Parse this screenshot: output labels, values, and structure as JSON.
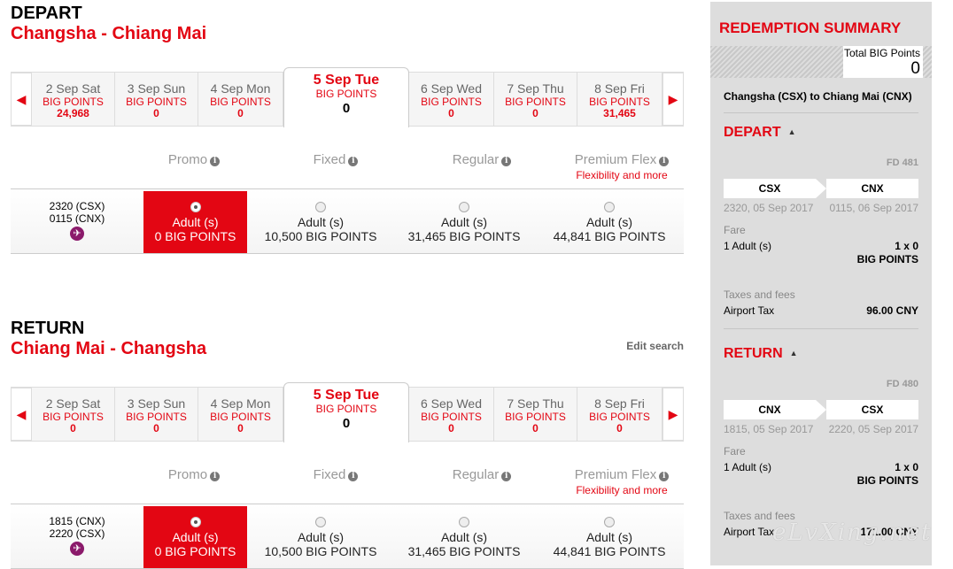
{
  "depart": {
    "heading": "DEPART",
    "route": "Changsha - Chiang Mai",
    "dates": [
      {
        "label": "2 Sep Sat",
        "bp": "BIG POINTS",
        "points": "24,968"
      },
      {
        "label": "3 Sep Sun",
        "bp": "BIG POINTS",
        "points": "0"
      },
      {
        "label": "4 Sep Mon",
        "bp": "BIG POINTS",
        "points": "0"
      },
      {
        "label": "5 Sep Tue",
        "bp": "BIG POINTS",
        "points": "0"
      },
      {
        "label": "6 Sep Wed",
        "bp": "BIG POINTS",
        "points": "0"
      },
      {
        "label": "7 Sep Thu",
        "bp": "BIG POINTS",
        "points": "0"
      },
      {
        "label": "8 Sep Fri",
        "bp": "BIG POINTS",
        "points": "31,465"
      }
    ],
    "fares": {
      "promo": "Promo",
      "fixed": "Fixed",
      "regular": "Regular",
      "premium": "Premium Flex",
      "premium_sub": "Flexibility and more"
    },
    "flight": {
      "dep": "2320 (CSX)",
      "arr": "0115 (CNX)"
    },
    "options": [
      {
        "adult": "Adult (s)",
        "points": "0 BIG POINTS"
      },
      {
        "adult": "Adult (s)",
        "points": "10,500 BIG POINTS"
      },
      {
        "adult": "Adult (s)",
        "points": "31,465 BIG POINTS"
      },
      {
        "adult": "Adult (s)",
        "points": "44,841 BIG POINTS"
      }
    ]
  },
  "return": {
    "heading": "RETURN",
    "route": "Chiang Mai - Changsha",
    "edit_search": "Edit search",
    "dates": [
      {
        "label": "2 Sep Sat",
        "bp": "BIG POINTS",
        "points": "0"
      },
      {
        "label": "3 Sep Sun",
        "bp": "BIG POINTS",
        "points": "0"
      },
      {
        "label": "4 Sep Mon",
        "bp": "BIG POINTS",
        "points": "0"
      },
      {
        "label": "5 Sep Tue",
        "bp": "BIG POINTS",
        "points": "0"
      },
      {
        "label": "6 Sep Wed",
        "bp": "BIG POINTS",
        "points": "0"
      },
      {
        "label": "7 Sep Thu",
        "bp": "BIG POINTS",
        "points": "0"
      },
      {
        "label": "8 Sep Fri",
        "bp": "BIG POINTS",
        "points": "0"
      }
    ],
    "fares": {
      "promo": "Promo",
      "fixed": "Fixed",
      "regular": "Regular",
      "premium": "Premium Flex",
      "premium_sub": "Flexibility and more"
    },
    "flight": {
      "dep": "1815 (CNX)",
      "arr": "2220 (CSX)"
    },
    "options": [
      {
        "adult": "Adult (s)",
        "points": "0 BIG POINTS"
      },
      {
        "adult": "Adult (s)",
        "points": "10,500 BIG POINTS"
      },
      {
        "adult": "Adult (s)",
        "points": "31,465 BIG POINTS"
      },
      {
        "adult": "Adult (s)",
        "points": "44,841 BIG POINTS"
      }
    ]
  },
  "summary": {
    "title": "REDEMPTION SUMMARY",
    "total_label": "Total BIG Points",
    "total_value": "0",
    "route_name": "Changsha (CSX) to Chiang Mai (CNX)",
    "depart": {
      "label": "DEPART",
      "flight_no": "FD 481",
      "from": "CSX",
      "to": "CNX",
      "from_time": "2320, 05 Sep 2017",
      "to_time": "0115, 06 Sep 2017",
      "fare_label": "Fare",
      "pax": "1 Adult (s)",
      "fare_value": "1 x 0",
      "fare_unit": "BIG POINTS",
      "tax_label": "Taxes and fees",
      "tax_name": "Airport Tax",
      "tax_value": "96.00 CNY"
    },
    "return": {
      "label": "RETURN",
      "flight_no": "FD 480",
      "from": "CNX",
      "to": "CSX",
      "from_time": "1815, 05 Sep 2017",
      "to_time": "2220, 05 Sep 2017",
      "fare_label": "Fare",
      "pax": "1 Adult (s)",
      "fare_value": "1 x 0",
      "fare_unit": "BIG POINTS",
      "tax_label": "Taxes and fees",
      "tax_name": "Airport Tax",
      "tax_value": "171.00 CNY"
    }
  },
  "watermark": "eLvXing.net",
  "colors": {
    "accent": "#e30613",
    "sidebar": "#dddddd"
  },
  "icons": {
    "prev": "chevron-left-icon",
    "next": "chevron-right-icon",
    "info": "info-icon",
    "flight": "airline-logo-icon"
  }
}
